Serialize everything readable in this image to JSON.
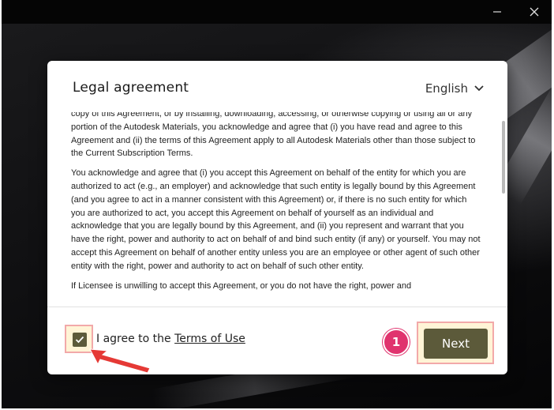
{
  "window": {
    "controls": {
      "minimize_glyph": "—",
      "close_glyph": "✕"
    }
  },
  "dialog": {
    "title": "Legal agreement",
    "language": {
      "selected": "English",
      "icon": "chevron-down-icon"
    },
    "agreement_paragraphs": [
      "copy of this Agreement, or by installing, downloading, accessing, or otherwise copying or using all or any portion of the Autodesk Materials, you acknowledge and agree that (i) you have read and agree to this Agreement and (ii) the terms of this Agreement apply to all Autodesk Materials other than those subject to the Current Subscription Terms.",
      "You acknowledge and agree that (i) you accept this Agreement on behalf of the entity for which you are authorized to act (e.g., an employer) and acknowledge that such entity is legally bound by this Agreement (and you agree to act in a manner consistent with this Agreement) or, if there is no such entity for which you are authorized to act, you accept this Agreement on behalf of yourself as an individual and acknowledge that you are legally bound by this Agreement, and (ii) you represent and warrant that you have the right, power and authority to act on behalf of and bind such entity (if any) or yourself.  You may not accept this Agreement on behalf of another entity unless you are an employee or other agent of such other entity with the right, power and authority to act on behalf of such other entity.",
      "If Licensee is unwilling to accept this Agreement, or you do not have the right, power and"
    ],
    "footer": {
      "agree_prefix": "I agree to the ",
      "terms_link": "Terms of Use",
      "checkbox_checked": true,
      "step_number": "1",
      "next_label": "Next"
    }
  },
  "colors": {
    "button_olive": "#5c5a3a",
    "highlight_border": "#f2a9a9",
    "highlight_fill": "#fff4d6",
    "step_badge": "#e0336e",
    "annotation_arrow": "#e53935"
  }
}
